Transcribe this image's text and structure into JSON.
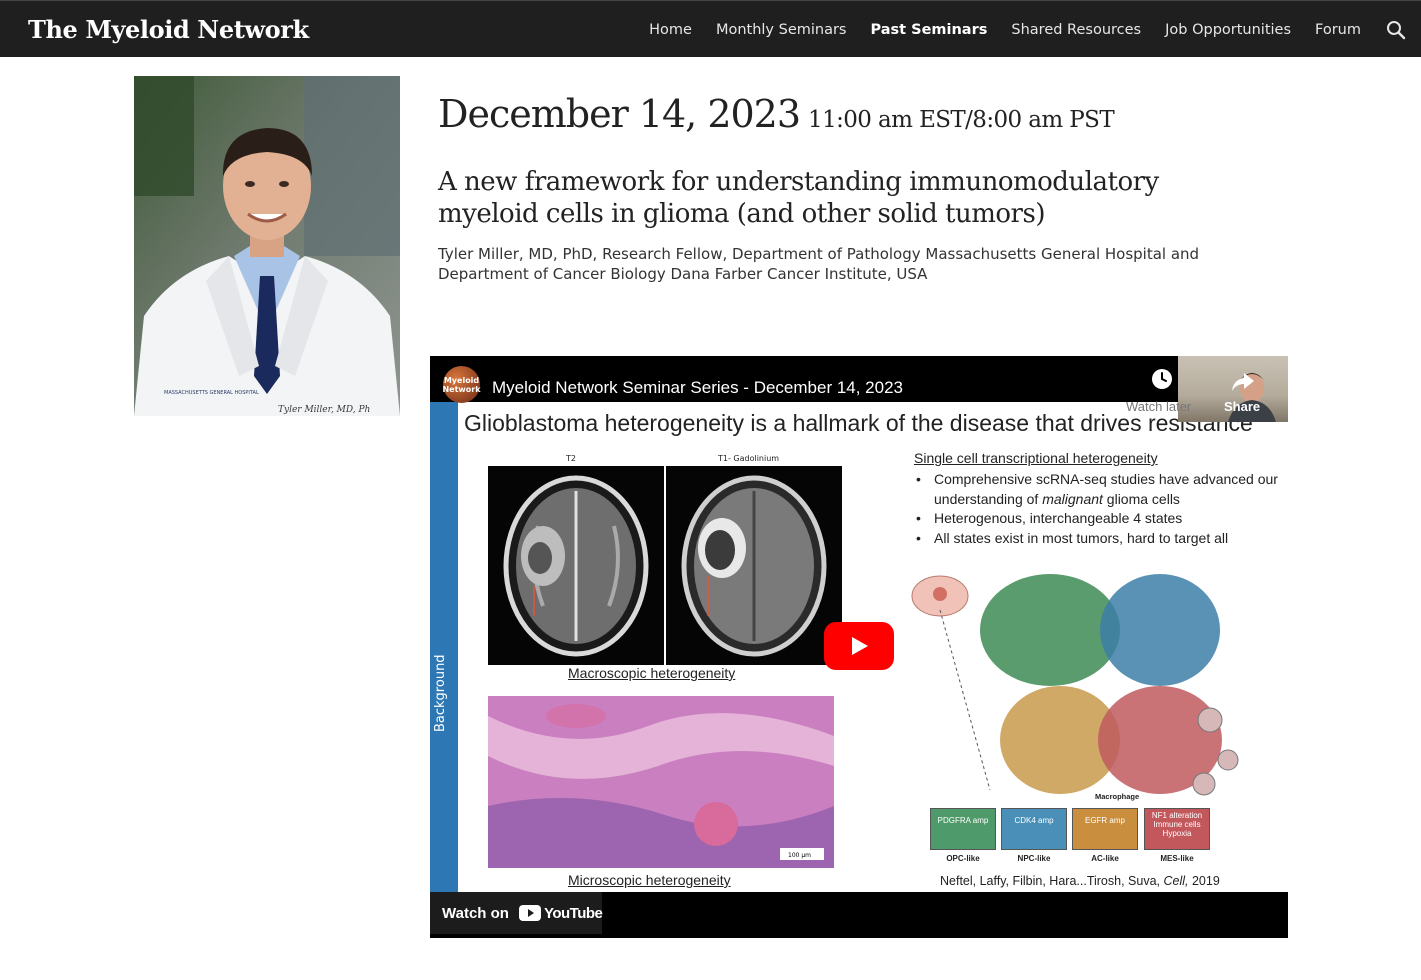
{
  "site": {
    "brand": "The Myeloid Network"
  },
  "nav": {
    "items": [
      {
        "label": "Home",
        "active": false
      },
      {
        "label": "Monthly Seminars",
        "active": false
      },
      {
        "label": "Past Seminars",
        "active": true
      },
      {
        "label": "Shared Resources",
        "active": false
      },
      {
        "label": "Job Opportunities",
        "active": false
      },
      {
        "label": "Forum",
        "active": false
      }
    ],
    "search_icon": "search-icon"
  },
  "speaker": {
    "photo_caption": "Tyler Miller, MD, Ph",
    "coat_badge": "MASSACHUSETTS GENERAL HOSPITAL"
  },
  "seminar": {
    "date": "December 14, 2023",
    "time": "11:00 am EST/8:00 am PST",
    "title": "A new framework for understanding immunomodulatory myeloid cells in glioma (and other solid tumors)",
    "speaker_affiliation": "Tyler Miller, MD, PhD, Research Fellow, Department of Pathology Massachusetts General Hospital and Department of Cancer Biology Dana Farber Cancer Institute, USA"
  },
  "video": {
    "channel_avatar_text": [
      "Myeloid",
      "Network"
    ],
    "title": "Myeloid Network Seminar Series - December 14, 2023",
    "watch_later_label": "Watch later",
    "share_label": "Share",
    "watch_on_label": "Watch on",
    "youtube_label": "YouTube",
    "slide": {
      "sidebar_label": "Background",
      "title": "Glioblastoma heterogeneity is a hallmark of the disease that drives resistance",
      "mri_labels": [
        "T2",
        "T1- Gadolinium"
      ],
      "macroscopic_caption": "Macroscopic heterogeneity",
      "microscopic_caption": "Microscopic heterogeneity",
      "scale_bar": "100 µm",
      "section_heading": "Single cell transcriptional heterogeneity",
      "bullet_1": "Comprehensive scRNA-seq studies have advanced our understanding of ",
      "bullet_1_em": "malignant",
      "bullet_1_end": " glioma cells",
      "bullet_2": "Heterogenous, interchangeable 4 states",
      "bullet_3": "All states exist in most tumors, hard to target all",
      "macrophage_label": "Macrophage",
      "states": [
        {
          "box": "PDGFRA amp",
          "label": "OPC-like",
          "color": "#4f9a6a"
        },
        {
          "box": "CDK4 amp",
          "label": "NPC-like",
          "color": "#4a8fb8"
        },
        {
          "box": "EGFR amp",
          "label": "AC-like",
          "color": "#c98e3e"
        },
        {
          "box": "NF1 alteration Immune cells Hypoxia",
          "label": "MES-like",
          "color": "#c2575c"
        }
      ],
      "citation_pre": "Neftel, Laffy, Filbin, Hara...Tirosh, Suva, ",
      "citation_journal": "Cell,",
      "citation_year": " 2019"
    }
  }
}
